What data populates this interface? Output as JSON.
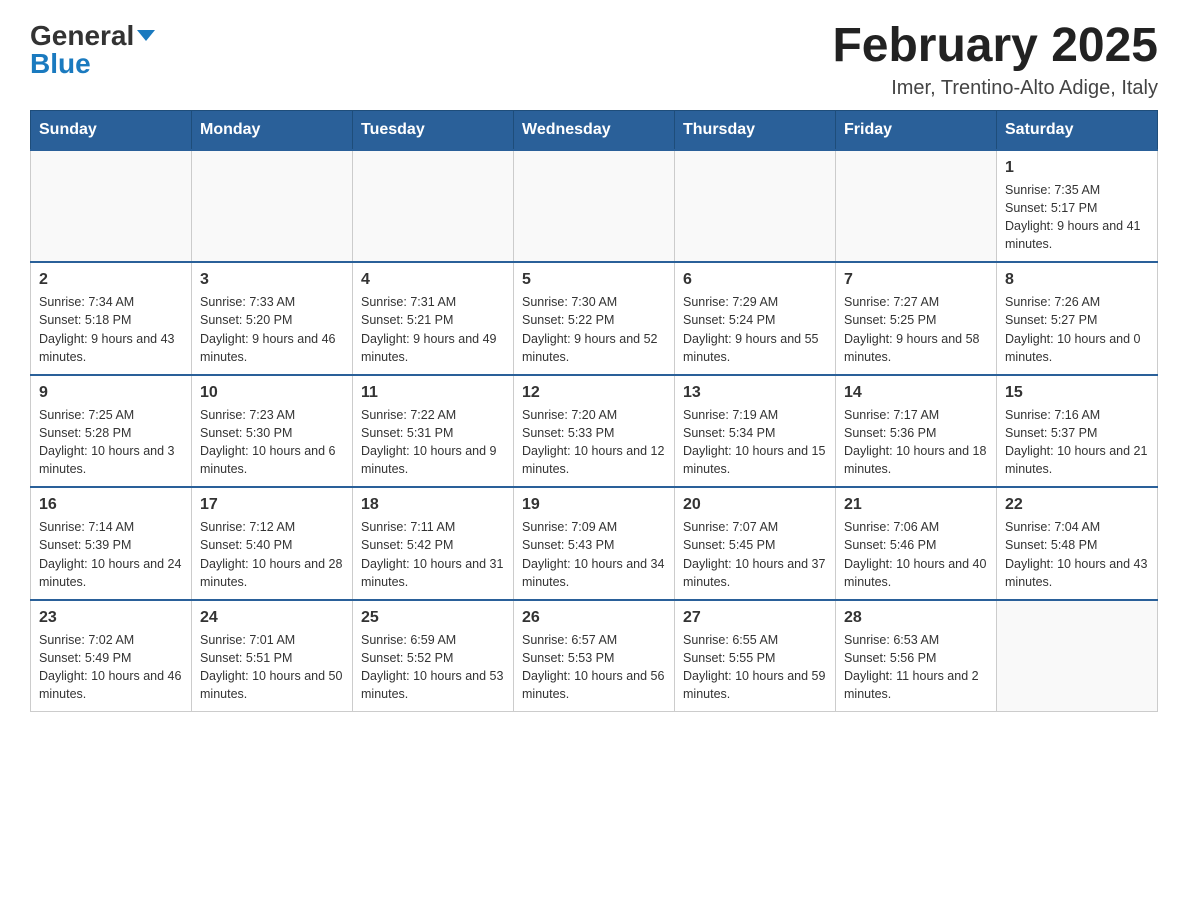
{
  "header": {
    "logo_general": "General",
    "logo_blue": "Blue",
    "title": "February 2025",
    "subtitle": "Imer, Trentino-Alto Adige, Italy"
  },
  "days_of_week": [
    "Sunday",
    "Monday",
    "Tuesday",
    "Wednesday",
    "Thursday",
    "Friday",
    "Saturday"
  ],
  "weeks": [
    [
      {
        "day": "",
        "info": ""
      },
      {
        "day": "",
        "info": ""
      },
      {
        "day": "",
        "info": ""
      },
      {
        "day": "",
        "info": ""
      },
      {
        "day": "",
        "info": ""
      },
      {
        "day": "",
        "info": ""
      },
      {
        "day": "1",
        "info": "Sunrise: 7:35 AM\nSunset: 5:17 PM\nDaylight: 9 hours and 41 minutes."
      }
    ],
    [
      {
        "day": "2",
        "info": "Sunrise: 7:34 AM\nSunset: 5:18 PM\nDaylight: 9 hours and 43 minutes."
      },
      {
        "day": "3",
        "info": "Sunrise: 7:33 AM\nSunset: 5:20 PM\nDaylight: 9 hours and 46 minutes."
      },
      {
        "day": "4",
        "info": "Sunrise: 7:31 AM\nSunset: 5:21 PM\nDaylight: 9 hours and 49 minutes."
      },
      {
        "day": "5",
        "info": "Sunrise: 7:30 AM\nSunset: 5:22 PM\nDaylight: 9 hours and 52 minutes."
      },
      {
        "day": "6",
        "info": "Sunrise: 7:29 AM\nSunset: 5:24 PM\nDaylight: 9 hours and 55 minutes."
      },
      {
        "day": "7",
        "info": "Sunrise: 7:27 AM\nSunset: 5:25 PM\nDaylight: 9 hours and 58 minutes."
      },
      {
        "day": "8",
        "info": "Sunrise: 7:26 AM\nSunset: 5:27 PM\nDaylight: 10 hours and 0 minutes."
      }
    ],
    [
      {
        "day": "9",
        "info": "Sunrise: 7:25 AM\nSunset: 5:28 PM\nDaylight: 10 hours and 3 minutes."
      },
      {
        "day": "10",
        "info": "Sunrise: 7:23 AM\nSunset: 5:30 PM\nDaylight: 10 hours and 6 minutes."
      },
      {
        "day": "11",
        "info": "Sunrise: 7:22 AM\nSunset: 5:31 PM\nDaylight: 10 hours and 9 minutes."
      },
      {
        "day": "12",
        "info": "Sunrise: 7:20 AM\nSunset: 5:33 PM\nDaylight: 10 hours and 12 minutes."
      },
      {
        "day": "13",
        "info": "Sunrise: 7:19 AM\nSunset: 5:34 PM\nDaylight: 10 hours and 15 minutes."
      },
      {
        "day": "14",
        "info": "Sunrise: 7:17 AM\nSunset: 5:36 PM\nDaylight: 10 hours and 18 minutes."
      },
      {
        "day": "15",
        "info": "Sunrise: 7:16 AM\nSunset: 5:37 PM\nDaylight: 10 hours and 21 minutes."
      }
    ],
    [
      {
        "day": "16",
        "info": "Sunrise: 7:14 AM\nSunset: 5:39 PM\nDaylight: 10 hours and 24 minutes."
      },
      {
        "day": "17",
        "info": "Sunrise: 7:12 AM\nSunset: 5:40 PM\nDaylight: 10 hours and 28 minutes."
      },
      {
        "day": "18",
        "info": "Sunrise: 7:11 AM\nSunset: 5:42 PM\nDaylight: 10 hours and 31 minutes."
      },
      {
        "day": "19",
        "info": "Sunrise: 7:09 AM\nSunset: 5:43 PM\nDaylight: 10 hours and 34 minutes."
      },
      {
        "day": "20",
        "info": "Sunrise: 7:07 AM\nSunset: 5:45 PM\nDaylight: 10 hours and 37 minutes."
      },
      {
        "day": "21",
        "info": "Sunrise: 7:06 AM\nSunset: 5:46 PM\nDaylight: 10 hours and 40 minutes."
      },
      {
        "day": "22",
        "info": "Sunrise: 7:04 AM\nSunset: 5:48 PM\nDaylight: 10 hours and 43 minutes."
      }
    ],
    [
      {
        "day": "23",
        "info": "Sunrise: 7:02 AM\nSunset: 5:49 PM\nDaylight: 10 hours and 46 minutes."
      },
      {
        "day": "24",
        "info": "Sunrise: 7:01 AM\nSunset: 5:51 PM\nDaylight: 10 hours and 50 minutes."
      },
      {
        "day": "25",
        "info": "Sunrise: 6:59 AM\nSunset: 5:52 PM\nDaylight: 10 hours and 53 minutes."
      },
      {
        "day": "26",
        "info": "Sunrise: 6:57 AM\nSunset: 5:53 PM\nDaylight: 10 hours and 56 minutes."
      },
      {
        "day": "27",
        "info": "Sunrise: 6:55 AM\nSunset: 5:55 PM\nDaylight: 10 hours and 59 minutes."
      },
      {
        "day": "28",
        "info": "Sunrise: 6:53 AM\nSunset: 5:56 PM\nDaylight: 11 hours and 2 minutes."
      },
      {
        "day": "",
        "info": ""
      }
    ]
  ]
}
